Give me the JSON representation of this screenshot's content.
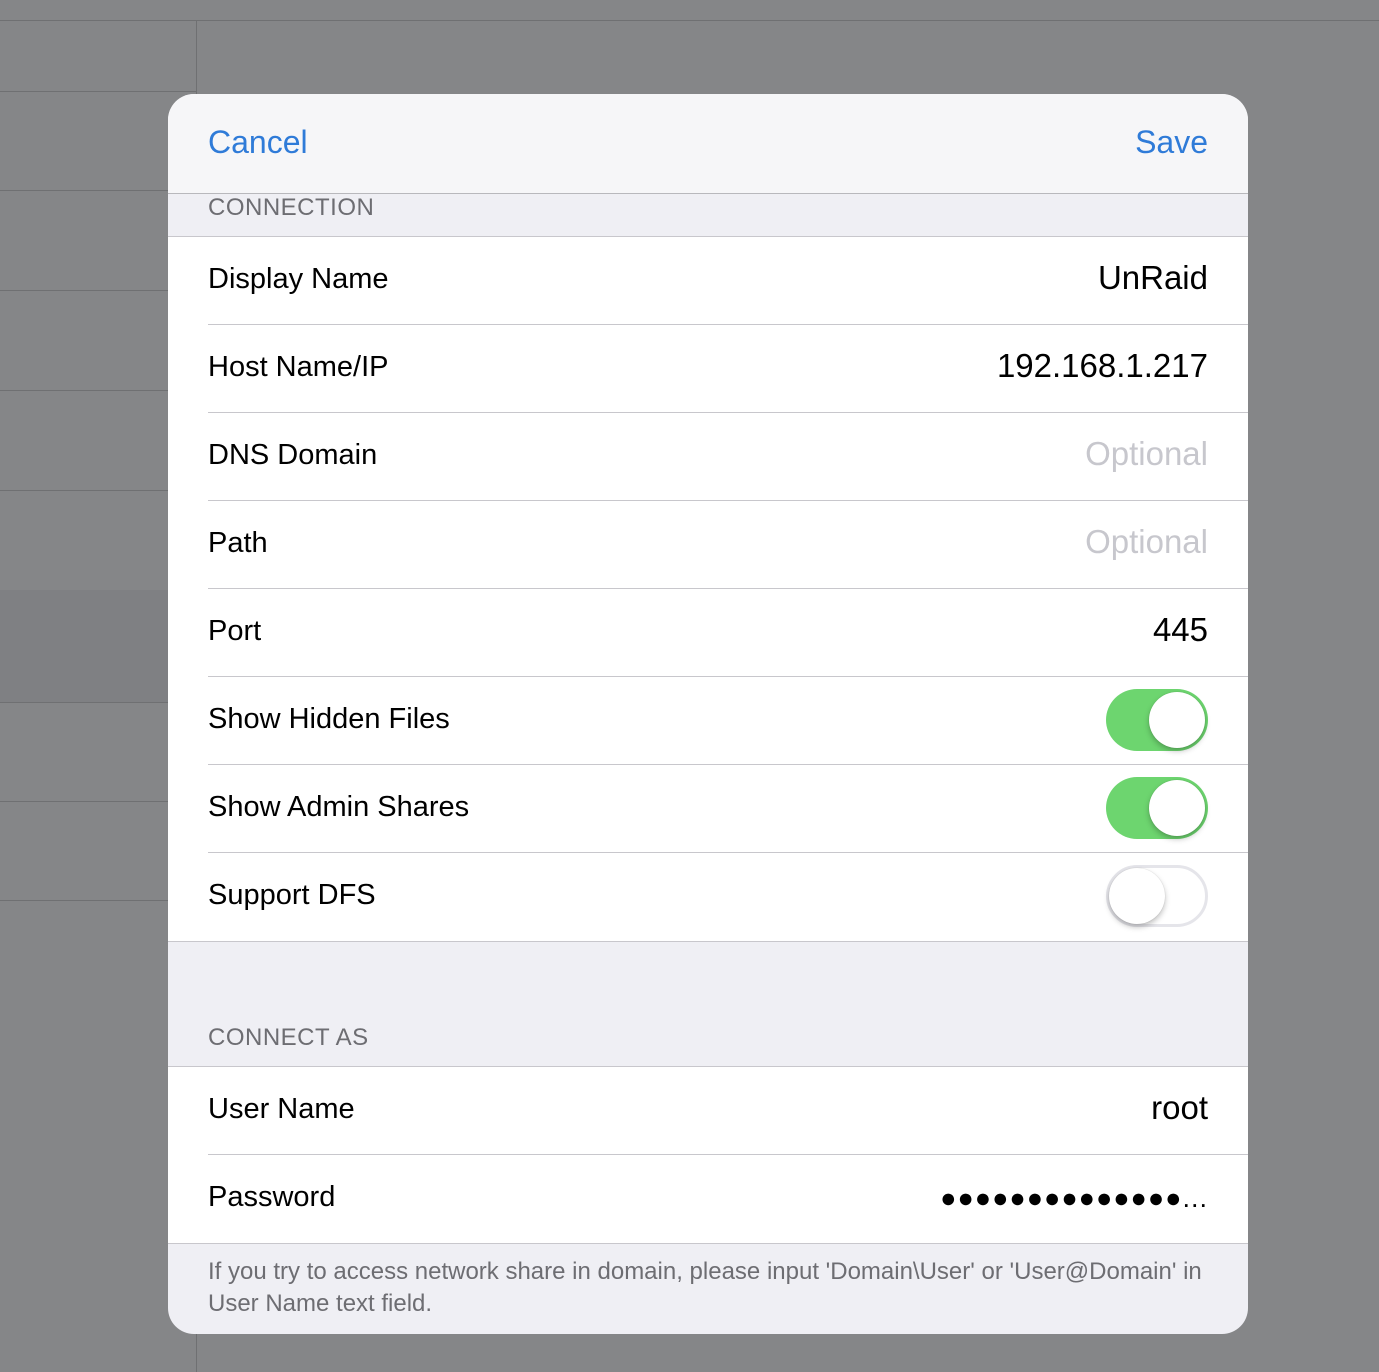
{
  "navbar": {
    "cancel_label": "Cancel",
    "save_label": "Save"
  },
  "connection": {
    "header": "CONNECTION",
    "rows": {
      "display_name": {
        "label": "Display Name",
        "value": "UnRaid"
      },
      "host": {
        "label": "Host Name/IP",
        "value": "192.168.1.217"
      },
      "dns_domain": {
        "label": "DNS Domain",
        "placeholder": "Optional"
      },
      "path": {
        "label": "Path",
        "placeholder": "Optional"
      },
      "port": {
        "label": "Port",
        "value": "445"
      },
      "show_hidden": {
        "label": "Show Hidden Files",
        "on": true
      },
      "show_admin": {
        "label": "Show Admin Shares",
        "on": true
      },
      "support_dfs": {
        "label": "Support DFS",
        "on": false
      }
    }
  },
  "connect_as": {
    "header": "CONNECT AS",
    "rows": {
      "user_name": {
        "label": "User Name",
        "value": "root"
      },
      "password": {
        "label": "Password",
        "value": "●●●●●●●●●●●●●●..."
      }
    },
    "footer": "If you try to access network share in domain, please input 'Domain\\User' or 'User@Domain' in  User Name text field."
  },
  "colors": {
    "accent": "#2f7bd8",
    "toggle_on": "#6dd56f",
    "placeholder": "#c7c7cd",
    "grouped_background": "#efeff4"
  }
}
